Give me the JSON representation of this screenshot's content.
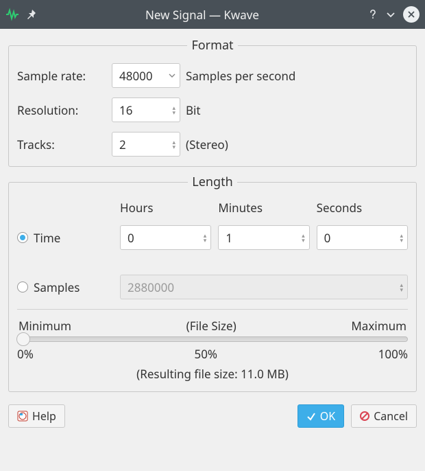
{
  "titlebar": {
    "title": "New Signal — Kwave"
  },
  "format": {
    "legend": "Format",
    "sample_rate_label": "Sample rate:",
    "sample_rate_value": "48000",
    "sample_rate_unit": "Samples per second",
    "resolution_label": "Resolution:",
    "resolution_value": "16",
    "resolution_unit": "Bit",
    "tracks_label": "Tracks:",
    "tracks_value": "2",
    "tracks_unit": "(Stereo)"
  },
  "length": {
    "legend": "Length",
    "hours_label": "Hours",
    "minutes_label": "Minutes",
    "seconds_label": "Seconds",
    "radio_time_label": "Time",
    "radio_samples_label": "Samples",
    "radio_selected": "time",
    "hours_value": "0",
    "minutes_value": "1",
    "seconds_value": "0",
    "samples_value": "2880000"
  },
  "filesize": {
    "min_label": "Minimum",
    "center_label": "(File Size)",
    "max_label": "Maximum",
    "tick_left": "0%",
    "tick_mid": "50%",
    "tick_right": "100%",
    "resulting_label": "(Resulting file size: 11.0 MB)",
    "slider_percent": 0
  },
  "buttons": {
    "help": "Help",
    "ok": "OK",
    "cancel": "Cancel"
  }
}
